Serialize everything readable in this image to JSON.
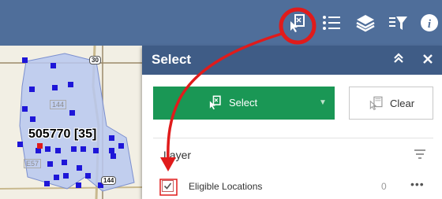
{
  "map": {
    "feature_label": "505770 [35]",
    "road_shields": [
      "30",
      "144",
      "144",
      "E57"
    ]
  },
  "toolbar": {
    "buttons": [
      "select-tool-icon",
      "list-icon",
      "layers-icon",
      "filter-icon",
      "info-icon"
    ]
  },
  "select_panel": {
    "title": "Select",
    "collapse_icon": "chevron-double-up-icon",
    "close_icon": "close-icon",
    "select_button_label": "Select",
    "clear_button_label": "Clear",
    "layer_heading": "Layer",
    "layers": [
      {
        "label": "Eligible Locations",
        "count": "0",
        "checked": true
      }
    ]
  },
  "colors": {
    "toolbar_bg": "#4f6e9a",
    "panel_header_bg": "#3f5c86",
    "select_button_bg": "#1a9755",
    "highlight_red": "#e01b1b",
    "parcel_fill": "#b9c8f0",
    "point_marker": "#1e16d8"
  }
}
